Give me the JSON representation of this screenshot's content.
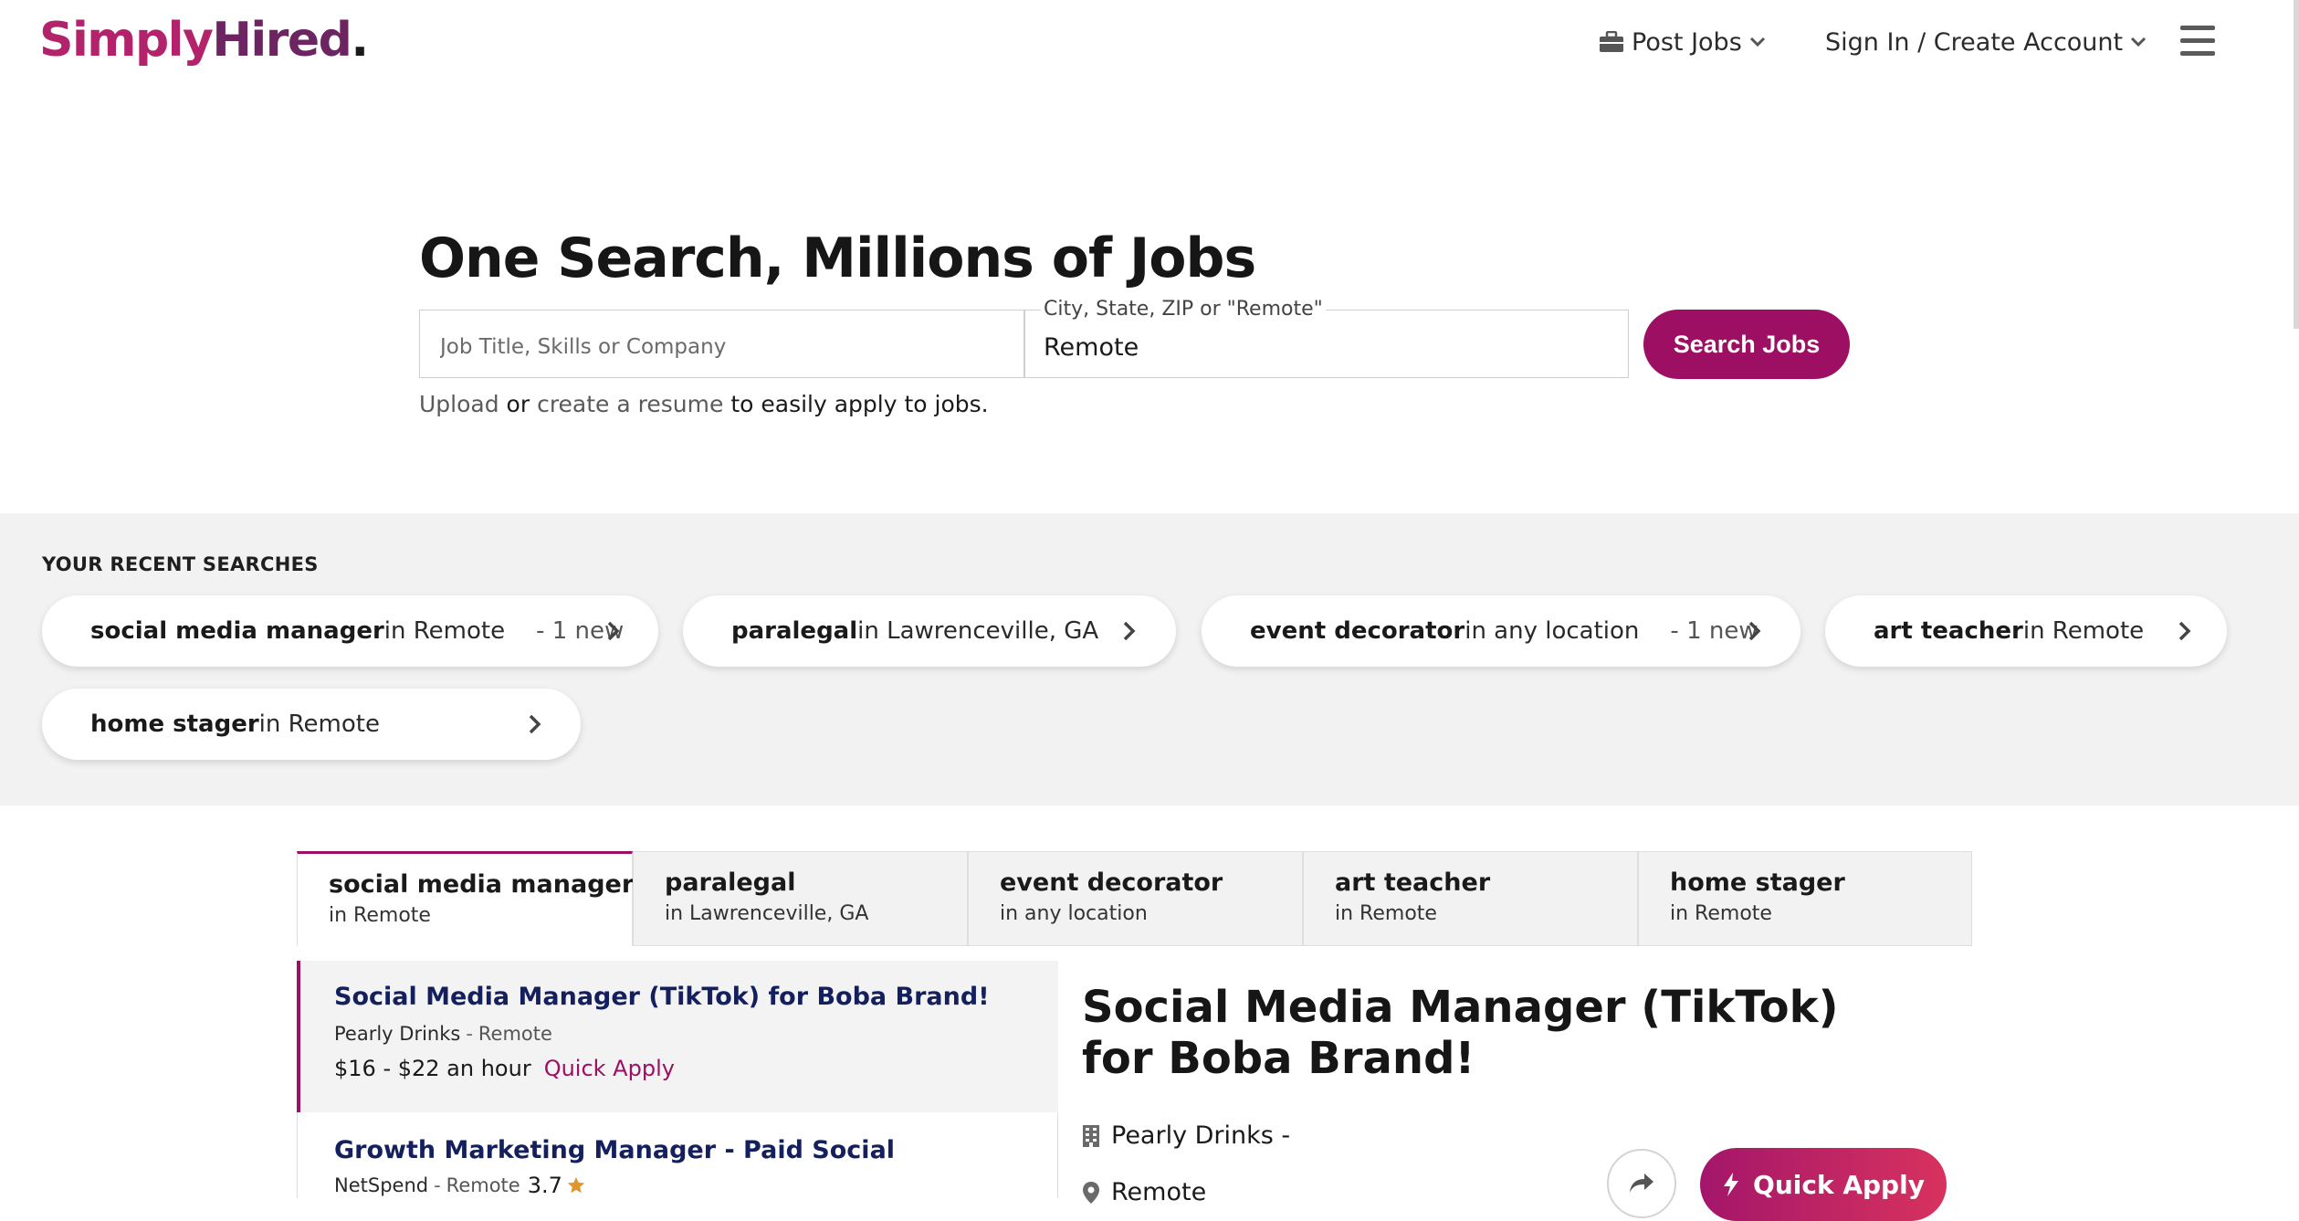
{
  "header": {
    "logo_part1": "Simply",
    "logo_part2": "Hired",
    "logo_dot": ".",
    "post_jobs": "Post Jobs",
    "sign_in": "Sign In / Create Account"
  },
  "hero": {
    "headline": "One Search, Millions of Jobs",
    "what_placeholder": "Job Title, Skills or Company",
    "where_label": "City, State, ZIP or \"Remote\"",
    "where_value": "Remote",
    "search_button": "Search Jobs",
    "upload_link": "Upload",
    "upload_or": " or ",
    "create_link": "create a resume",
    "upload_tail": " to easily apply to jobs."
  },
  "recent": {
    "title": "YOUR RECENT SEARCHES",
    "chips": [
      {
        "query": "social media manager",
        "location": " in Remote",
        "badge": "- 1 new"
      },
      {
        "query": "paralegal",
        "location": " in Lawrenceville, GA",
        "badge": ""
      },
      {
        "query": "event decorator",
        "location": " in any location",
        "badge": "- 1 new"
      },
      {
        "query": "art teacher",
        "location": " in Remote",
        "badge": ""
      },
      {
        "query": "home stager",
        "location": " in Remote",
        "badge": ""
      }
    ]
  },
  "tabs": [
    {
      "query": "social media manager",
      "location": "in Remote"
    },
    {
      "query": "paralegal",
      "location": "in Lawrenceville, GA"
    },
    {
      "query": "event decorator",
      "location": "in any location"
    },
    {
      "query": "art teacher",
      "location": "in Remote"
    },
    {
      "query": "home stager",
      "location": "in Remote"
    }
  ],
  "jobs": [
    {
      "title": "Social Media Manager (TikTok) for Boba Brand!",
      "company": "Pearly Drinks",
      "sep": "-",
      "location": "Remote",
      "pay": "$16 - $22 an hour",
      "quick_apply": "Quick Apply"
    },
    {
      "title": "Growth Marketing Manager - Paid Social",
      "company": "NetSpend",
      "sep": "-",
      "location": "Remote",
      "rating": "3.7"
    }
  ],
  "detail": {
    "title": "Social Media Manager (TikTok) for Boba Brand!",
    "company": "Pearly Drinks -",
    "location": "Remote",
    "quick_apply": "Quick Apply"
  },
  "colors": {
    "brand_primary": "#9c0f62",
    "logo_pink": "#b3236c",
    "logo_purple": "#6d2562",
    "job_title_navy": "#14205e",
    "star": "#e0962b"
  },
  "icons": [
    "briefcase-icon",
    "chevron-down-icon",
    "hamburger-menu-icon",
    "chevron-right-icon",
    "star-icon",
    "building-icon",
    "location-pin-icon",
    "share-icon",
    "lightning-icon"
  ]
}
